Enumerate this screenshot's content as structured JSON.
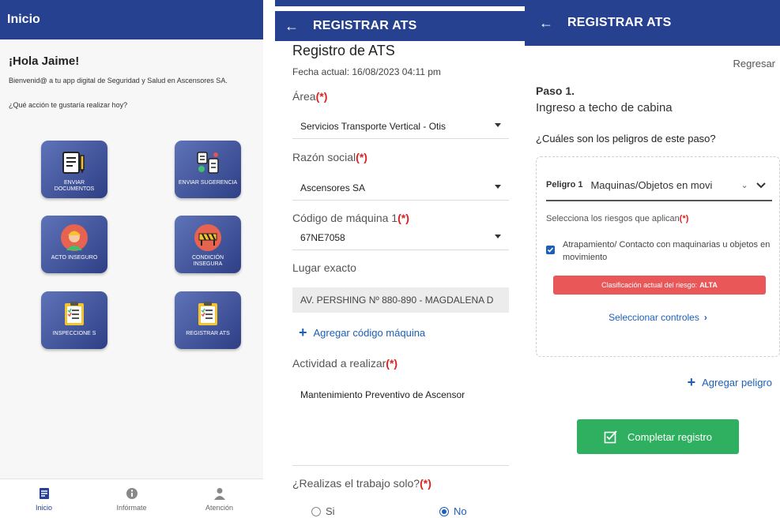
{
  "home": {
    "appbar_title": "Inicio",
    "greeting": "¡Hola Jaime!",
    "welcome": "Bienvenid@ a tu app digital de Seguridad y Salud en Ascensores SA.",
    "question": "¿Qué acción te gustaría realizar hoy?",
    "tiles": [
      {
        "label": "ENVIAR DOCUMENTOS",
        "icon": "document-icon"
      },
      {
        "label": "ENVIAR SUGERENCIA",
        "icon": "suggestion-icon"
      },
      {
        "label": "ACTO INSEGURO",
        "icon": "worker-icon"
      },
      {
        "label": "CONDICIÓN INSEGURA",
        "icon": "barrier-icon"
      },
      {
        "label": "INSPECCIONE S",
        "icon": "clipboard-icon"
      },
      {
        "label": "REGISTRAR ATS",
        "icon": "clipboard-icon"
      }
    ],
    "nav": [
      {
        "label": "Inicio",
        "icon": "home-icon"
      },
      {
        "label": "Infórmate",
        "icon": "info-icon"
      },
      {
        "label": "Atención",
        "icon": "person-icon"
      }
    ]
  },
  "form": {
    "appbar_title": "REGISTRAR ATS",
    "title": "Registro de ATS",
    "date": "Fecha actual: 16/08/2023 04:11 pm",
    "area_label": "Área",
    "area_value": "Servicios Transporte Vertical - Otis",
    "razon_label": "Razón social",
    "razon_value": "Ascensores SA",
    "codigo_label": "Código de máquina 1",
    "codigo_value": "67NE7058",
    "lugar_label": "Lugar exacto",
    "lugar_value": "AV. PERSHING Nº 880-890 - MAGDALENA D",
    "add_codigo": "Agregar código máquina",
    "actividad_label": "Actividad a realizar",
    "actividad_value": "Mantenimiento Preventivo de Ascensor",
    "solo_label": "¿Realizas el trabajo solo?",
    "required_mark": "(*)",
    "option_si": "Si",
    "option_no": "No",
    "selected": "No"
  },
  "step": {
    "appbar_title": "REGISTRAR ATS",
    "regresar": "Regresar",
    "paso_num": "Paso 1.",
    "paso_name": "Ingreso a techo de cabina",
    "peligros_q": "¿Cuáles son los peligros de este paso?",
    "peligro_label": "Peligro 1",
    "peligro_value": "Maquinas/Objetos en movi",
    "riesgos_label": "Selecciona los riesgos que aplican",
    "required_mark": "(*)",
    "riesgo_item": "Atrapamiento/ Contacto con maquinarias u objetos en movimiento",
    "riesgo_checked": true,
    "clasificacion_text": "Clasificación actual del riesgo:",
    "clasificacion_value": "ALTA",
    "controles_link": "Seleccionar controles",
    "add_peligro": "Agregar peligro",
    "complete_button": "Completar registro"
  },
  "colors": {
    "appbar": "#26418f",
    "link": "#1c5fb8",
    "danger": "#e95758",
    "success": "#2fb061",
    "required": "#e02020"
  }
}
